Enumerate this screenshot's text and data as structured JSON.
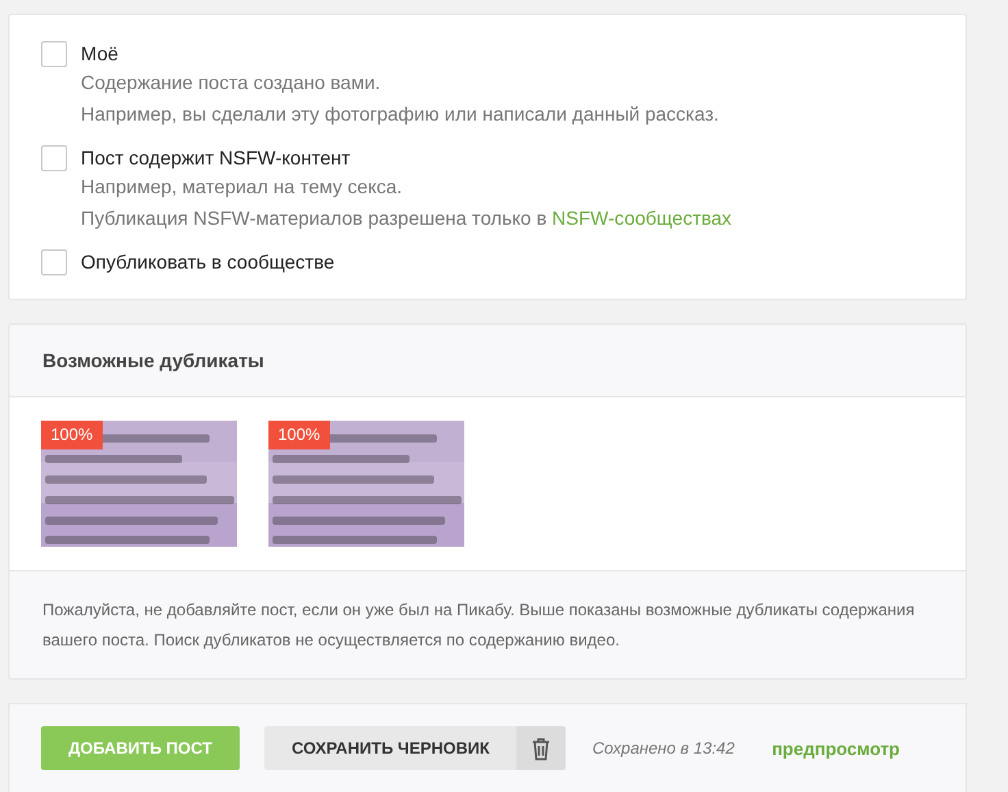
{
  "options": [
    {
      "label": "Моё",
      "checked": false,
      "lines": [
        {
          "text": "Содержание поста создано вами."
        },
        {
          "text": "Например, вы сделали эту фотографию или написали данный рассказ."
        }
      ]
    },
    {
      "label": "Пост содержит NSFW-контент",
      "checked": false,
      "lines": [
        {
          "text": "Например, материал на тему секса."
        },
        {
          "text": "Публикация NSFW-материалов разрешена только в",
          "link": "NSFW-сообществах"
        }
      ]
    },
    {
      "label": "Опубликовать в сообществе",
      "checked": false
    }
  ],
  "duplicates": {
    "title": "Возможные дубликаты",
    "items": [
      {
        "kind": "picture",
        "badge": "100%"
      },
      {
        "kind": "picture",
        "badge": "100%"
      }
    ],
    "note": "Пожалуйста, не добавляйте пост, если он уже был на Пикабу. Выше показаны возможные дубликаты содержания вашего поста. Поиск дубликатов не осуществляется по содержанию видео."
  },
  "actions": {
    "add": "ДОБАВИТЬ ПОСТ",
    "save_draft": "СОХРАНИТЬ ЧЕРНОВИК",
    "saved": "Сохранено в 13:42",
    "preview": "предпросмотр"
  }
}
